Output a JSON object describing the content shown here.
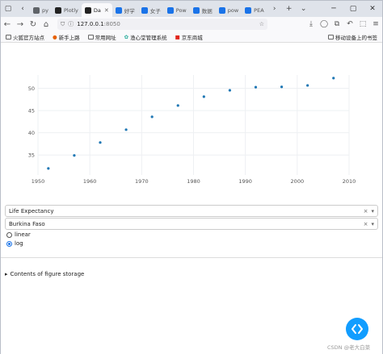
{
  "browser": {
    "tabs": [
      {
        "label": "py",
        "color": "#5f6368"
      },
      {
        "label": "Plotly",
        "color": "#222"
      },
      {
        "label": "Da",
        "color": "#222",
        "active": true
      },
      {
        "label": "好学",
        "color": "#1a73e8"
      },
      {
        "label": "女子",
        "color": "#1a73e8"
      },
      {
        "label": "Pow",
        "color": "#1a73e8"
      },
      {
        "label": "数据",
        "color": "#1a73e8"
      },
      {
        "label": "pow",
        "color": "#1a73e8"
      },
      {
        "label": "PEA",
        "color": "#1a73e8"
      }
    ],
    "new_tab": "+",
    "url_host": "127.0.0.1",
    "url_port": ":8050",
    "bookmarks": [
      "火狐官方站点",
      "新手上路",
      "常用网址",
      "渔心堂管理系统",
      "京东商城"
    ],
    "bookmark_right": "移动设备上的书签"
  },
  "chart_data": {
    "type": "scatter",
    "title": "",
    "xlabel": "",
    "ylabel": "",
    "xlim": [
      1950,
      2010
    ],
    "ylim": [
      30.5,
      53
    ],
    "xticks": [
      1950,
      1960,
      1970,
      1980,
      1990,
      2000,
      2010
    ],
    "yticks": [
      35,
      40,
      45,
      50
    ],
    "x": [
      1952,
      1957,
      1962,
      1967,
      1972,
      1977,
      1982,
      1987,
      1992,
      1997,
      2002,
      2007
    ],
    "y": [
      31.975,
      34.906,
      37.814,
      40.697,
      43.591,
      46.137,
      48.122,
      49.557,
      50.26,
      50.324,
      50.65,
      52.295
    ],
    "marker_color": "#1f77b4",
    "grid": true
  },
  "controls": {
    "yaxis_dropdown": "Life Expectancy",
    "country_dropdown": "Burkina Faso",
    "clear": "×",
    "arrow": "▾",
    "radio_options": [
      "linear",
      "log"
    ],
    "radio_selected": "log"
  },
  "details_summary": "Contents of figure storage",
  "watermark": "CSDN @老大白菜"
}
